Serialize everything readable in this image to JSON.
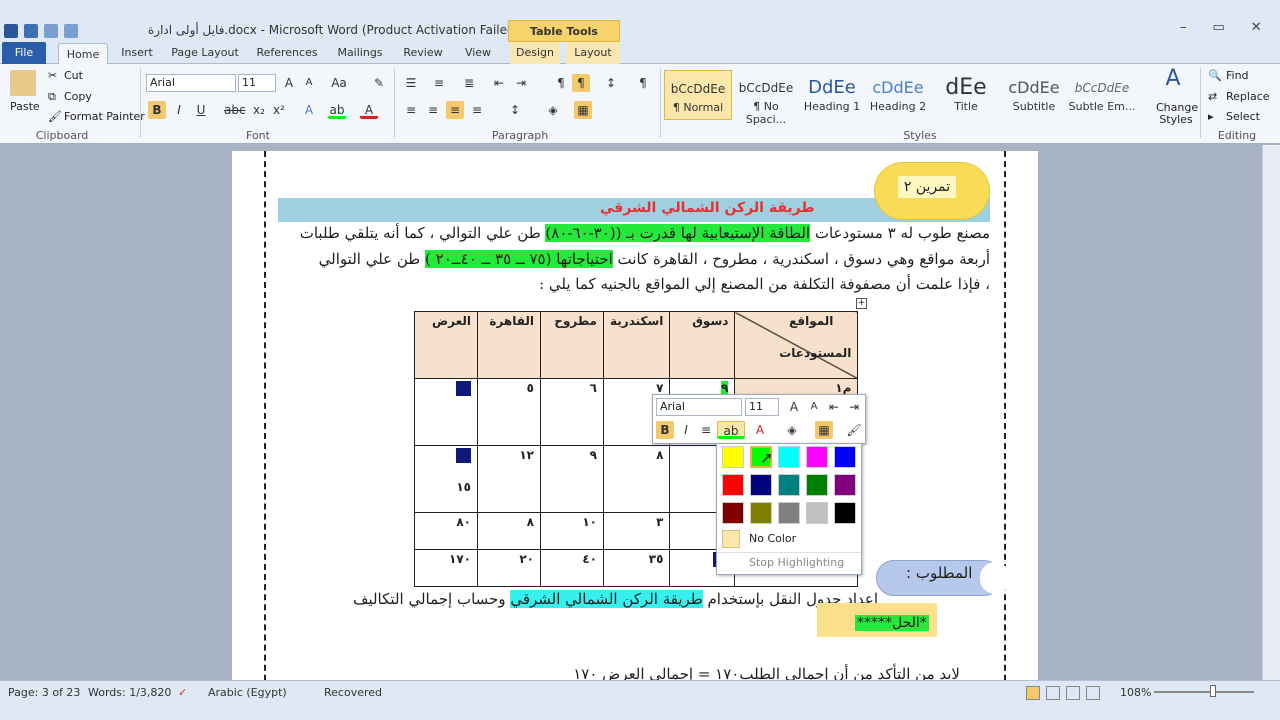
{
  "window": {
    "title": "فايل أولى ادارة.docx  -  Microsoft Word (Product Activation Failed)",
    "contextual_tab": "Table Tools",
    "controls": [
      "–",
      "▭",
      "✕"
    ]
  },
  "tabs": [
    "File",
    "Home",
    "Insert",
    "Page Layout",
    "References",
    "Mailings",
    "Review",
    "View",
    "Design",
    "Layout"
  ],
  "clipboard": {
    "paste": "Paste",
    "cut": "Cut",
    "copy": "Copy",
    "format_painter": "Format Painter",
    "label": "Clipboard"
  },
  "font": {
    "name": "Arial",
    "size": "11",
    "label": "Font"
  },
  "paragraph": {
    "label": "Paragraph"
  },
  "styles": {
    "label": "Styles",
    "items": [
      {
        "sample": "bCcDdEe",
        "name": "¶ Normal"
      },
      {
        "sample": "bCcDdEe",
        "name": "¶ No Spaci..."
      },
      {
        "sample": "DdEe",
        "name": "Heading 1"
      },
      {
        "sample": "cDdEe",
        "name": "Heading 2"
      },
      {
        "sample": "dEe",
        "name": "Title"
      },
      {
        "sample": "cDdEe",
        "name": "Subtitle"
      },
      {
        "sample": "bCcDdEe",
        "name": "Subtle Em..."
      }
    ],
    "change_styles": "Change Styles"
  },
  "editing": {
    "find": "Find",
    "replace": "Replace",
    "select": "Select",
    "label": "Editing"
  },
  "document": {
    "exercise": "تمرين ٢",
    "heading": "طريقة الركن الشمالي الشرقي",
    "line1_a": "مصنع طوب له ٣ مستودعات ",
    "line1_hl": "الطاقة الإستيعابية لها قدرت بـ ((٣٠-٦٠-٨٠)",
    "line1_b": " طن علي التوالي ، كما أنه يتلقي طلبات",
    "line2_a": "أربعة مواقع وهي دسوق ، اسكندرية ، مطروح ، القاهرة  كانت ",
    "line2_hl": "احتياجاتها (٧٥ ــ ٣٥ ــ ٤٠ــ٢٠ )",
    "line2_b": " طن علي التوالي",
    "line3": "، فإذا علمت أن مصفوفة  التكلفة من المصنع  إلي المواقع  بالجنيه كما يلي :",
    "required": "المطلوب :",
    "task_a": "إعداد جدول النقل بإستخدام ",
    "task_hl": "طريقة الركن الشمالي الشرقي",
    "task_b": " وحساب إجمالي التكاليف",
    "solution": "*الحل*****",
    "footer_line": "لابد من التأكد من أن إجمالي الطلب١٧٠ = إجمالي العرض ١٧٠"
  },
  "table": {
    "header_sites": "المواقع",
    "header_warehouses": "المستودعات",
    "columns": [
      "دسوق",
      "اسكندرية",
      "مطروح",
      "القاهرة",
      "العرض"
    ],
    "rows": [
      {
        "label": "م١",
        "cells": [
          "٩",
          "٧",
          "٦",
          "٥",
          ""
        ]
      },
      {
        "label": "",
        "cells": [
          "٤",
          "٨",
          "٩",
          "١٢",
          "١٥"
        ]
      },
      {
        "label": "",
        "cells": [
          "",
          "٣",
          "١٠",
          "٨",
          "٨٠"
        ]
      },
      {
        "label": "",
        "cells": [
          "",
          "٣٥",
          "٤٠",
          "٢٠",
          "١٧٠"
        ]
      }
    ]
  },
  "mini_toolbar": {
    "font": "Arial",
    "size": "11"
  },
  "highlight_palette": {
    "colors": [
      "#ffff00",
      "#00ff00",
      "#00ffff",
      "#ff00ff",
      "#0000ff",
      "#ff0000",
      "#000080",
      "#008080",
      "#008000",
      "#800080",
      "#800000",
      "#808000",
      "#808080",
      "#c0c0c0",
      "#000000"
    ],
    "no_color": "No Color",
    "stop": "Stop Highlighting"
  },
  "status": {
    "page": "Page: 3 of 23",
    "words": "Words: 1/3,820",
    "language": "Arabic (Egypt)",
    "recovered": "Recovered",
    "zoom": "108%"
  }
}
